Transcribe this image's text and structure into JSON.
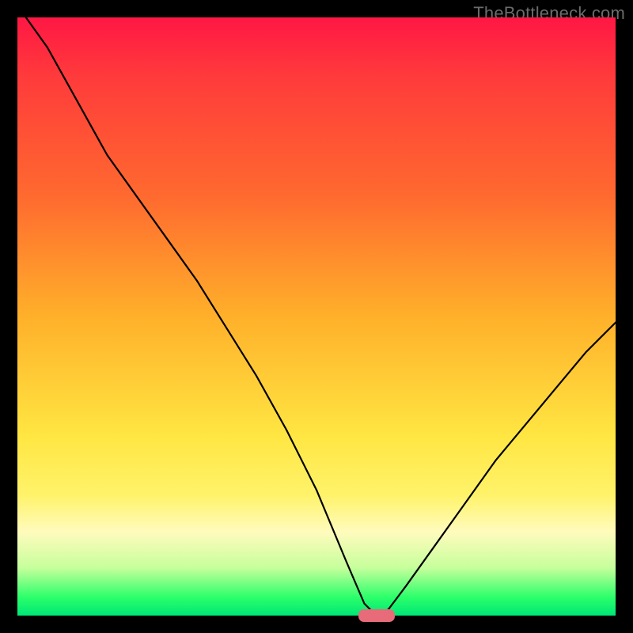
{
  "watermark": "TheBottleneck.com",
  "chart_data": {
    "type": "line",
    "title": "",
    "xlabel": "",
    "ylabel": "",
    "xlim": [
      0,
      100
    ],
    "ylim": [
      0,
      100
    ],
    "series": [
      {
        "name": "bottleneck-curve",
        "x": [
          0,
          5,
          10,
          15,
          20,
          25,
          30,
          35,
          40,
          45,
          50,
          55,
          58,
          60,
          62,
          65,
          70,
          75,
          80,
          85,
          90,
          95,
          100
        ],
        "values": [
          102,
          95,
          86,
          77,
          70,
          63,
          56,
          48,
          40,
          31,
          21,
          9,
          2,
          0,
          1,
          5,
          12,
          19,
          26,
          32,
          38,
          44,
          49
        ]
      }
    ],
    "annotations": [
      {
        "name": "optimal-point",
        "x": 60,
        "y": 0
      }
    ],
    "gradient_note": "background encodes bottleneck severity: red=high, green=low"
  }
}
